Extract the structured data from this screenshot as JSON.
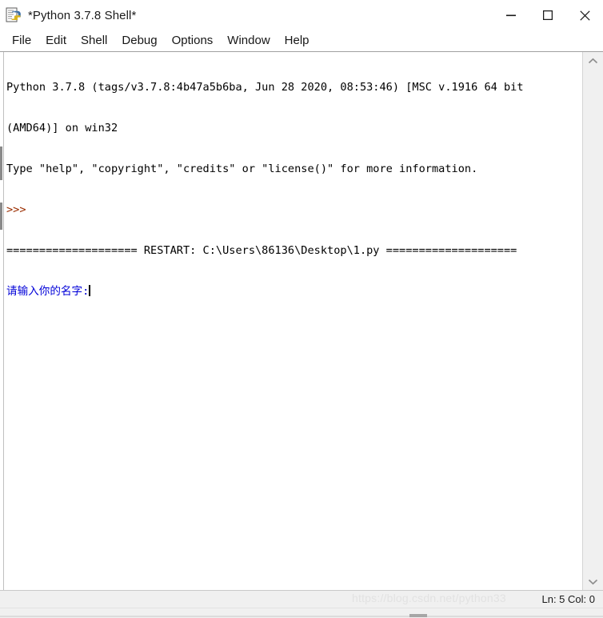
{
  "window": {
    "title": "*Python 3.7.8 Shell*",
    "icon": "python-idle-icon",
    "controls": {
      "minimize_label": "Minimize",
      "maximize_label": "Maximize",
      "close_label": "Close"
    }
  },
  "menubar": {
    "items": [
      {
        "label": "File"
      },
      {
        "label": "Edit"
      },
      {
        "label": "Shell"
      },
      {
        "label": "Debug"
      },
      {
        "label": "Options"
      },
      {
        "label": "Window"
      },
      {
        "label": "Help"
      }
    ]
  },
  "shell": {
    "lines": [
      {
        "id": "banner-1",
        "color": "black",
        "text": "Python 3.7.8 (tags/v3.7.8:4b47a5b6ba, Jun 28 2020, 08:53:46) [MSC v.1916 64 bit"
      },
      {
        "id": "banner-2",
        "color": "black",
        "text": "(AMD64)] on win32"
      },
      {
        "id": "banner-3",
        "color": "black",
        "text": "Type \"help\", \"copyright\", \"credits\" or \"license()\" for more information."
      },
      {
        "id": "prompt",
        "color": "prompt",
        "text": ">>>"
      },
      {
        "id": "restart",
        "color": "black",
        "text": "==================== RESTART: C:\\Users\\86136\\Desktop\\1.py ===================="
      },
      {
        "id": "input-prompt",
        "color": "blue",
        "text": "请输入你的名字:"
      }
    ]
  },
  "scrollbar": {
    "up_arrow": "chevron-up-icon",
    "down_arrow": "chevron-down-icon"
  },
  "statusbar": {
    "position": "Ln: 5  Col: 0",
    "watermark": "https://blog.csdn.net/python33"
  },
  "colors": {
    "prompt_red": "#9b2d00",
    "input_blue": "#0000d8",
    "text_black": "#000000",
    "chrome_bg": "#ffffff",
    "status_bg": "#f0f0f0"
  }
}
